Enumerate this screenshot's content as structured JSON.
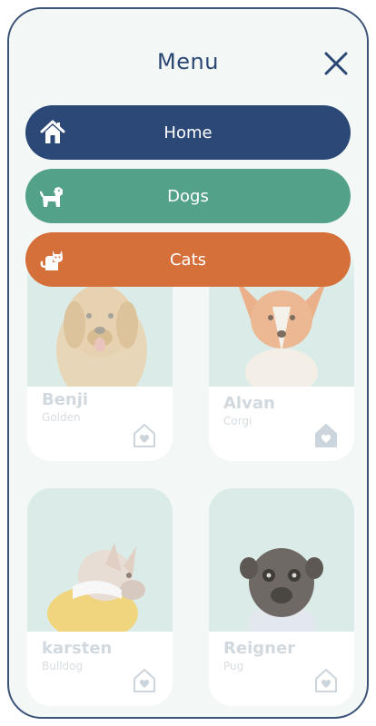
{
  "menu": {
    "title": "Menu",
    "items": [
      {
        "label": "Home",
        "icon": "home-icon",
        "color": "#2b4877"
      },
      {
        "label": "Dogs",
        "icon": "dog-icon",
        "color": "#53a189"
      },
      {
        "label": "Cats",
        "icon": "cat-icon",
        "color": "#d5703b"
      }
    ]
  },
  "pets": [
    {
      "name": "Benji",
      "breed": "Golden"
    },
    {
      "name": "Alvan",
      "breed": "Corgi"
    },
    {
      "name": "karsten",
      "breed": "Bulldog"
    },
    {
      "name": "Reigner",
      "breed": "Pug"
    }
  ],
  "colors": {
    "primary": "#2b4877",
    "dogs": "#53a189",
    "cats": "#d5703b",
    "card_bg": "#dbece8"
  }
}
